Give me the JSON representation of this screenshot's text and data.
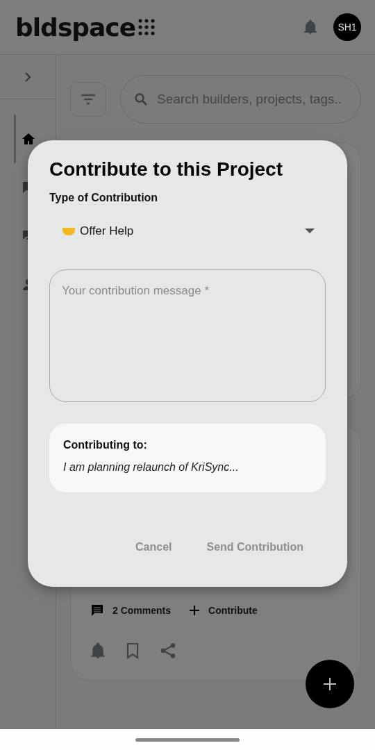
{
  "app_bar": {
    "logo": "bldspace",
    "avatar": "SH1"
  },
  "sidebar": {
    "items": [
      {
        "kind": "home",
        "selected": true
      },
      {
        "kind": "chat",
        "selected": false
      },
      {
        "kind": "forum",
        "selected": false
      },
      {
        "kind": "person",
        "selected": false
      }
    ]
  },
  "search": {
    "placeholder": "Search builders, projects, tags.."
  },
  "post": {
    "comments": "2 Comments",
    "contribute": "Contribute"
  },
  "dialog": {
    "title": "Contribute to this Project",
    "type_label": "Type of Contribution",
    "type_value": "Offer Help",
    "message_placeholder": "Your contribution message *",
    "context_label": "Contributing to:",
    "context_text": "I am planning relaunch of KriSync...",
    "buttons": [
      {
        "label": "Cancel",
        "disabled": true
      },
      {
        "label": "Send Contribution",
        "disabled": true
      }
    ]
  }
}
